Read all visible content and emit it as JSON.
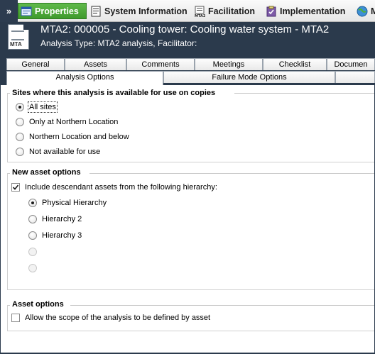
{
  "toolbar": {
    "expand_glyph": "»",
    "items": [
      {
        "label": "Properties"
      },
      {
        "label": "System Information"
      },
      {
        "label": "Facilitation"
      },
      {
        "label": "Implementation"
      },
      {
        "label": "M"
      }
    ]
  },
  "header": {
    "title": "MTA2: 000005 - Cooling tower: Cooling water system - MTA2",
    "subtitle": "Analysis Type: MTA2 analysis, Facilitator:",
    "icon_tag": "MTA"
  },
  "tabs": {
    "row1": [
      "General",
      "Assets",
      "Comments",
      "Meetings",
      "Checklist",
      "Documen"
    ],
    "row2": [
      "Analysis Options",
      "Failure Mode Options",
      ""
    ]
  },
  "sites": {
    "title": "Sites where this analysis is available for use on copies",
    "options": [
      "All sites",
      "Only at Northern Location",
      "Northern Location and below",
      "Not available for use"
    ],
    "selected": "All sites"
  },
  "new_asset": {
    "title": "New asset options",
    "include_label": "Include descendant assets from the following hierarchy:",
    "include_checked": true,
    "hierarchies": [
      "Physical Hierarchy",
      "Hierarchy 2",
      "Hierarchy 3"
    ],
    "selected": "Physical Hierarchy"
  },
  "asset_options": {
    "title": "Asset options",
    "scope_label": "Allow the scope of the analysis to be defined by asset",
    "scope_checked": false
  }
}
